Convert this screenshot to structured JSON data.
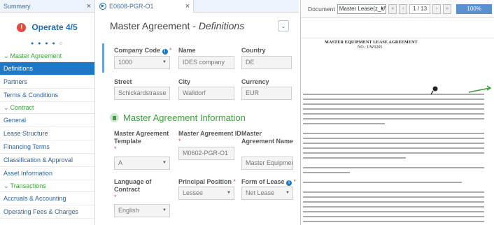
{
  "sidebar": {
    "tab_label": "Summary",
    "tab_close": "×",
    "operate_label": "Operate 4/5",
    "warn_glyph": "!",
    "dots": "● ● ● ● ○",
    "sections": [
      {
        "label": "Master Agreement",
        "items": [
          "Definitions",
          "Partners",
          "Terms & Conditions"
        ]
      },
      {
        "label": "Contract",
        "items": [
          "General",
          "Lease Structure",
          "Financing Terms",
          "Classification & Approval",
          "Asset Information"
        ]
      },
      {
        "label": "Transactions",
        "items": [
          "Accruals & Accounting",
          "Operating Fees & Charges"
        ]
      }
    ],
    "active_item": "Definitions",
    "colors": {
      "active_bg": "#1e78c8",
      "section_green": "#3aa13a",
      "link_blue": "#2c5f9a"
    }
  },
  "middle": {
    "tab_label": "E0608-PGR-O1",
    "tab_close": "×",
    "title_main": "Master Agreement - ",
    "title_italic": "Definitions",
    "collapse_icon": "⌄",
    "company": {
      "code_label": "Company Code",
      "code_value": "1000",
      "name_label": "Name",
      "name_value": "IDES company",
      "country_label": "Country",
      "country_value": "DE",
      "street_label": "Street",
      "street_value": "Schickardstrasse",
      "city_label": "City",
      "city_value": "Walldorf",
      "currency_label": "Currency",
      "currency_value": "EUR"
    },
    "section_title": "Master Agreement Information",
    "info": {
      "template_label": "Master Agreement Template",
      "template_value": "A",
      "id_label": "Master Agreement ID",
      "id_value": "M0602-PGR-O1",
      "name_label": "Master Agreement Name",
      "name_value": "Master Equipment I",
      "language_label": "Language of Contract",
      "language_value": "English",
      "position_label": "Principal Position",
      "position_value": "Lessee",
      "form_label": "Form of Lease",
      "form_value": "Net Lease"
    },
    "required_mark": "*",
    "info_glyph": "i"
  },
  "viewer": {
    "document_label": "Document",
    "document_value": "Master Lease(z_UW",
    "first_btn": "«",
    "prev_btn": "‹",
    "page_indicator": "1 / 13",
    "next_btn": "›",
    "last_btn": "»",
    "zoom": "100%",
    "doc_title": "MASTER EQUIPMENT LEASE AGREEMENT",
    "doc_no": "NO.: UW0205"
  }
}
